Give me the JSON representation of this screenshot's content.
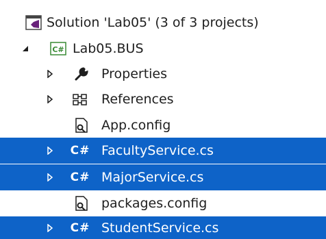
{
  "solution_explorer": {
    "solution": {
      "label": "Solution 'Lab05' (3 of 3 projects)",
      "icon": "solution-icon"
    },
    "project": {
      "label": "Lab05.BUS",
      "icon": "csharp-project-icon",
      "expanded": true
    },
    "items": [
      {
        "label": "Properties",
        "icon": "wrench-icon",
        "expandable": true,
        "selected": false
      },
      {
        "label": "References",
        "icon": "references-icon",
        "expandable": true,
        "selected": false
      },
      {
        "label": "App.config",
        "icon": "config-file-icon",
        "expandable": false,
        "selected": false
      },
      {
        "label": "FacultyService.cs",
        "icon": "csharp-file-icon",
        "icon_text": "C#",
        "expandable": true,
        "selected": true
      },
      {
        "label": "MajorService.cs",
        "icon": "csharp-file-icon",
        "icon_text": "C#",
        "expandable": true,
        "selected": true
      },
      {
        "label": "packages.config",
        "icon": "config-file-icon",
        "expandable": false,
        "selected": false
      },
      {
        "label": "StudentService.cs",
        "icon": "csharp-file-icon",
        "icon_text": "C#",
        "expandable": true,
        "selected": true
      }
    ],
    "colors": {
      "selection": "#0e63c8",
      "solution_icon": "#68217a",
      "project_icon": "#388a34"
    }
  }
}
